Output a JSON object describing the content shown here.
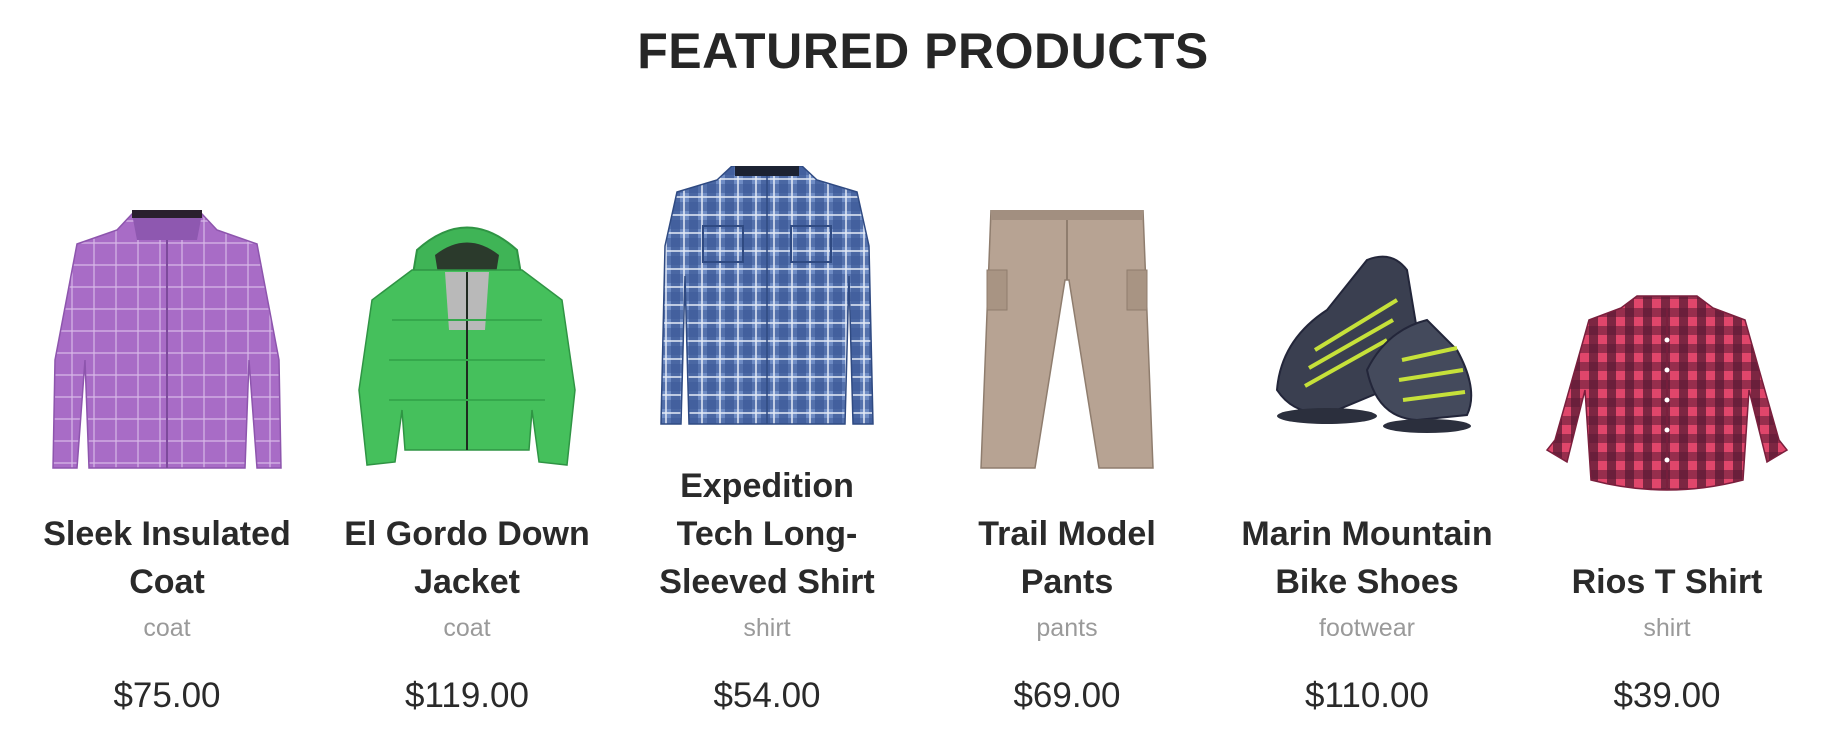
{
  "section": {
    "title": "FEATURED PRODUCTS"
  },
  "products": [
    {
      "title_lines": [
        "Sleek Insulated",
        "Coat"
      ],
      "category": "coat",
      "price": "$75.00",
      "image": "purple-plaid-coat-image",
      "image_color": "#a86cc6"
    },
    {
      "title_lines": [
        "El Gordo Down",
        "Jacket"
      ],
      "category": "coat",
      "price": "$119.00",
      "image": "green-down-jacket-image",
      "image_color": "#43c05a"
    },
    {
      "title_lines": [
        "Expedition",
        "Tech Long-",
        "Sleeved Shirt"
      ],
      "category": "shirt",
      "price": "$54.00",
      "image": "blue-plaid-shirt-image",
      "image_color": "#4a6aa6"
    },
    {
      "title_lines": [
        "Trail Model",
        "Pants"
      ],
      "category": "pants",
      "price": "$69.00",
      "image": "khaki-pants-image",
      "image_color": "#b7a393"
    },
    {
      "title_lines": [
        "Marin Mountain",
        "Bike Shoes"
      ],
      "category": "footwear",
      "price": "$110.00",
      "image": "bike-shoes-image",
      "image_color": "#3a3f50"
    },
    {
      "title_lines": [
        "Rios T Shirt"
      ],
      "category": "shirt",
      "price": "$39.00",
      "image": "pink-plaid-shirt-image",
      "image_color": "#e0466b"
    }
  ]
}
